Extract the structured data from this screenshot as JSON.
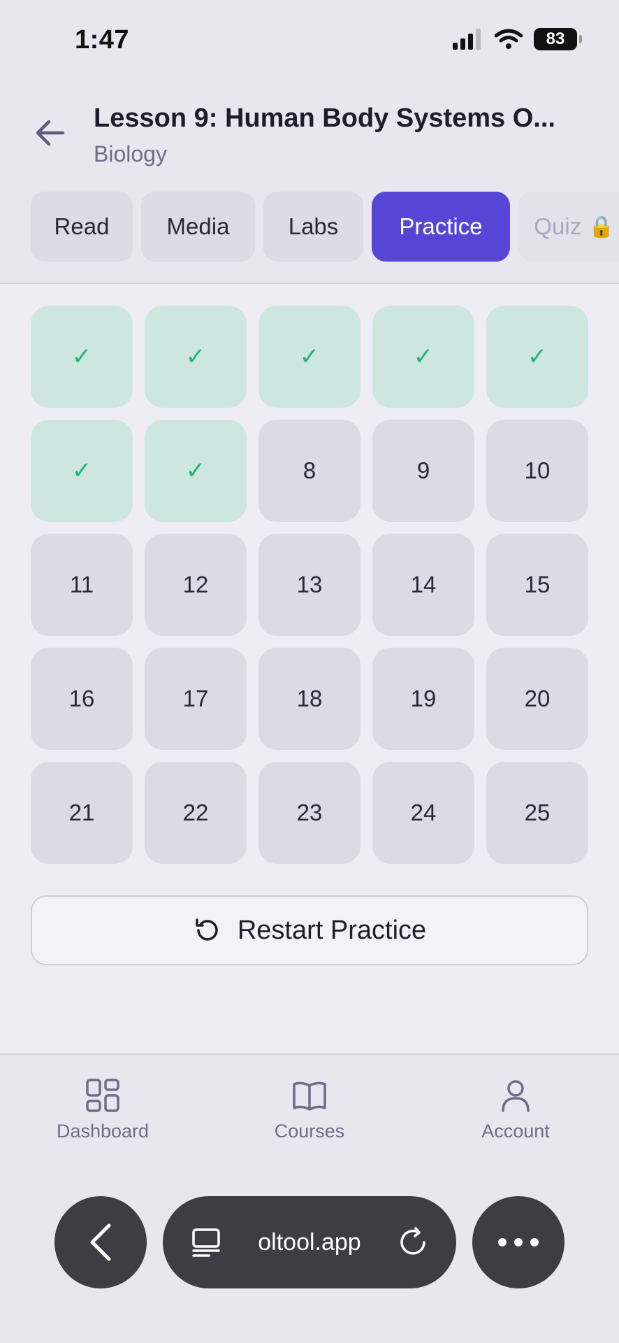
{
  "status": {
    "time": "1:47",
    "battery": "83"
  },
  "header": {
    "title": "Lesson 9: Human Body Systems O...",
    "subject": "Biology"
  },
  "tabs": [
    {
      "label": "Read"
    },
    {
      "label": "Media"
    },
    {
      "label": "Labs"
    },
    {
      "label": "Practice"
    },
    {
      "label": "Quiz"
    }
  ],
  "practice": {
    "check_symbol": "✓",
    "numbers": [
      "8",
      "9",
      "10",
      "11",
      "12",
      "13",
      "14",
      "15",
      "16",
      "17",
      "18",
      "19",
      "20",
      "21",
      "22",
      "23",
      "24",
      "25"
    ],
    "restart_label": "Restart Practice"
  },
  "nav": {
    "dashboard": "Dashboard",
    "courses": "Courses",
    "account": "Account"
  },
  "browser": {
    "url": "oltool.app"
  },
  "colors": {
    "accent": "#5746d6",
    "done_bg": "#cde7e0",
    "done_check": "#22b573"
  }
}
